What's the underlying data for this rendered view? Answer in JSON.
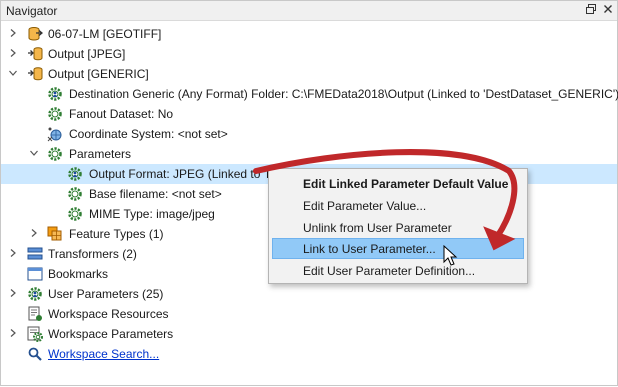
{
  "window": {
    "title": "Navigator",
    "restore_icon": "restore-window-icon",
    "close_icon": "close-icon"
  },
  "tree": {
    "items": [
      {
        "label": "06-07-LM [GEOTIFF]",
        "icon": "reader-dataset-icon",
        "expander": "collapsed"
      },
      {
        "label": "Output [JPEG]",
        "icon": "writer-dataset-icon",
        "expander": "collapsed"
      },
      {
        "label": "Output [GENERIC]",
        "icon": "writer-dataset-icon",
        "expander": "expanded"
      },
      {
        "label": "Destination Generic (Any Format) Folder: C:\\FMEData2018\\Output (Linked to 'DestDataset_GENERIC')",
        "icon": "gear-user-icon"
      },
      {
        "label": "Fanout Dataset: No",
        "icon": "gear-icon"
      },
      {
        "label": "Coordinate System: <not set>",
        "icon": "coordinate-system-icon"
      },
      {
        "label": "Parameters",
        "icon": "gear-icon",
        "expander": "expanded"
      },
      {
        "label": "Output Format: JPEG (Linked to 'F",
        "icon": "gear-user-icon",
        "selected": true
      },
      {
        "label": "Base filename: <not set>",
        "icon": "gear-icon"
      },
      {
        "label": "MIME Type: image/jpeg",
        "icon": "gear-icon"
      },
      {
        "label": "Feature Types (1)",
        "icon": "feature-types-icon",
        "expander": "collapsed"
      },
      {
        "label": "Transformers (2)",
        "icon": "transformers-icon",
        "expander": "collapsed"
      },
      {
        "label": "Bookmarks",
        "icon": "bookmarks-icon"
      },
      {
        "label": "User Parameters (25)",
        "icon": "user-parameters-icon",
        "expander": "collapsed"
      },
      {
        "label": "Workspace Resources",
        "icon": "workspace-resources-icon"
      },
      {
        "label": "Workspace Parameters",
        "icon": "workspace-parameters-icon",
        "expander": "collapsed"
      },
      {
        "label": "Workspace Search...",
        "icon": "search-icon",
        "link": true
      }
    ]
  },
  "context_menu": {
    "items": [
      {
        "label": "Edit Linked Parameter Default Value",
        "bold": true
      },
      {
        "label": "Edit Parameter Value..."
      },
      {
        "label": "Unlink from User Parameter"
      },
      {
        "label": "Link to User Parameter...",
        "highlighted": true
      },
      {
        "label": "Edit User Parameter Definition..."
      }
    ]
  },
  "colors": {
    "selection": "#cce8ff",
    "menu_highlight": "#91c9f7",
    "annotation_arrow": "#c0282a",
    "link": "#0033cc"
  }
}
